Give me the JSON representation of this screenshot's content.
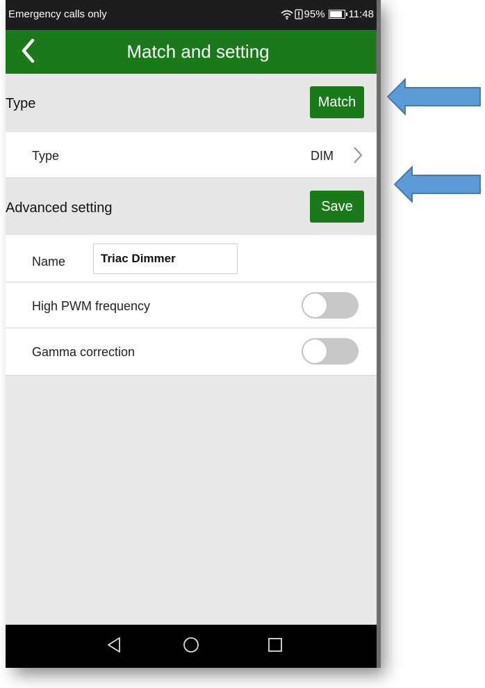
{
  "status_bar": {
    "carrier": "Emergency calls only",
    "battery_percent": "95%",
    "battery_level": 0.95,
    "time": "11:48",
    "icons": [
      "wifi-icon",
      "alert-icon",
      "battery-icon"
    ]
  },
  "app_bar": {
    "title": "Match and setting",
    "back_icon": "chevron-left-icon"
  },
  "type_section": {
    "header": "Type",
    "match_label": "Match",
    "type_row": {
      "label": "Type",
      "value": "DIM",
      "icon": "chevron-right-icon"
    }
  },
  "advanced_section": {
    "header": "Advanced setting",
    "save_label": "Save",
    "name_row": {
      "label": "Name",
      "value": "Triac Dimmer"
    },
    "pwm_row": {
      "label": "High PWM frequency",
      "enabled": false
    },
    "gamma_row": {
      "label": "Gamma correction",
      "enabled": false
    }
  },
  "nav_bar": {
    "icons": [
      "back-triangle-icon",
      "home-circle-icon",
      "recents-square-icon"
    ]
  },
  "colors": {
    "brand_green": "#1a7a1a",
    "arrow_blue": "#5b9bd5",
    "arrow_border": "#41719c",
    "toggle_off": "#c8c8c8",
    "background": "#e8e8e8"
  }
}
